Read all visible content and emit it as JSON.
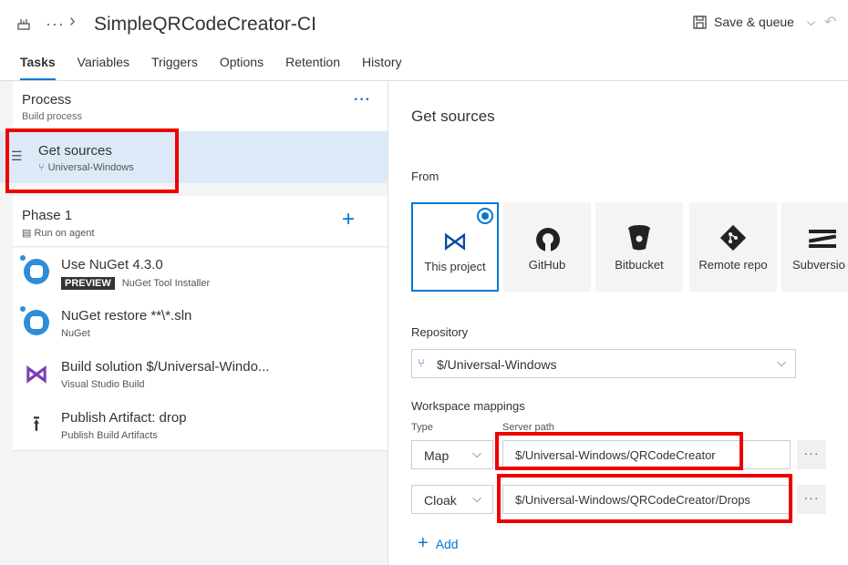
{
  "header": {
    "more_label": "···",
    "title": "SimpleQRCodeCreator-CI",
    "save_label": "Save & queue"
  },
  "tabs": [
    {
      "label": "Tasks",
      "active": true
    },
    {
      "label": "Variables"
    },
    {
      "label": "Triggers"
    },
    {
      "label": "Options"
    },
    {
      "label": "Retention"
    },
    {
      "label": "History"
    }
  ],
  "process": {
    "title": "Process",
    "subtitle": "Build process",
    "menu": "···"
  },
  "get_sources": {
    "title": "Get sources",
    "subtitle": "Universal-Windows"
  },
  "phase": {
    "title": "Phase 1",
    "subtitle": "Run on agent",
    "add_symbol": "+"
  },
  "tasks": [
    {
      "title": "Use NuGet 4.3.0",
      "badge": "PREVIEW",
      "subtitle": "NuGet Tool Installer",
      "icon": "nuget-icon"
    },
    {
      "title": "NuGet restore **\\*.sln",
      "subtitle": "NuGet",
      "icon": "nuget-icon"
    },
    {
      "title": "Build solution $/Universal-Windo...",
      "subtitle": "Visual Studio Build",
      "icon": "visual-studio-icon"
    },
    {
      "title": "Publish Artifact: drop",
      "subtitle": "Publish Build Artifacts",
      "icon": "upload-icon"
    }
  ],
  "details": {
    "title": "Get sources",
    "from_label": "From",
    "sources": [
      {
        "name": "This project",
        "icon": "visual-studio-icon",
        "selected": true
      },
      {
        "name": "GitHub",
        "icon": "github-icon"
      },
      {
        "name": "Bitbucket",
        "icon": "bitbucket-icon"
      },
      {
        "name": "Remote repo",
        "icon": "git-icon"
      },
      {
        "name": "Subversio",
        "icon": "subversion-icon"
      }
    ],
    "repository_label": "Repository",
    "repository_value": "$/Universal-Windows",
    "workspace_label": "Workspace mappings",
    "type_header": "Type",
    "server_path_header": "Server path",
    "mappings": [
      {
        "type": "Map",
        "path": "$/Universal-Windows/QRCodeCreator"
      },
      {
        "type": "Cloak",
        "path": "$/Universal-Windows/QRCodeCreator/Drops"
      }
    ],
    "ellipsis": "···",
    "add_label": "Add"
  },
  "colors": {
    "accent": "#0078d4",
    "highlight": "#ee0000",
    "selection": "#dceaf8"
  }
}
